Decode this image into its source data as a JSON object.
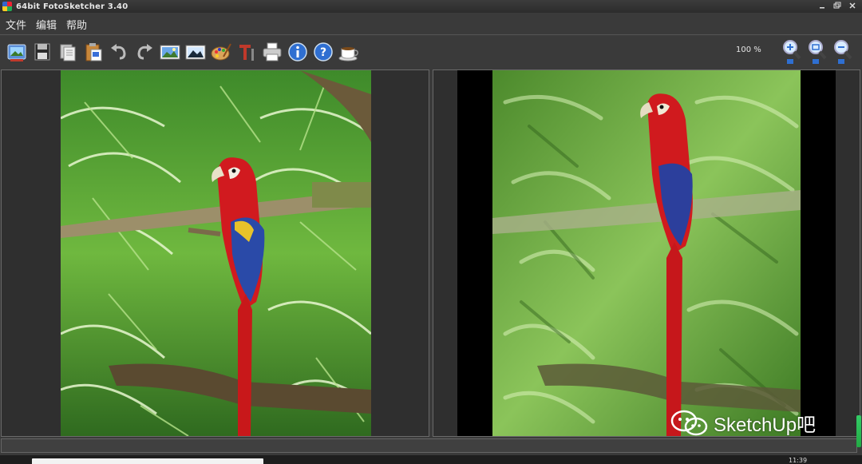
{
  "window": {
    "title": "64bit FotoSketcher 3.40",
    "controls": [
      "minimize-icon",
      "restore-icon",
      "close-icon"
    ]
  },
  "menu": {
    "items": [
      "文件",
      "编辑",
      "帮助"
    ]
  },
  "toolbar": {
    "buttons": [
      "open-image-icon",
      "save-icon",
      "copy-icon",
      "paste-icon",
      "undo-icon",
      "redo-icon",
      "original-image-icon",
      "result-image-icon",
      "drawing-parameters-icon",
      "text-icon",
      "print-icon",
      "info-icon",
      "help-icon",
      "coffee-icon"
    ],
    "zoom_label": "100 %",
    "zoom_buttons": [
      "zoom-in-icon",
      "zoom-fit-icon",
      "zoom-out-icon"
    ]
  },
  "panels": {
    "original": {
      "content": "parrot-photo"
    },
    "result": {
      "content": "parrot-painting"
    }
  },
  "watermark": {
    "text": "SketchUp吧"
  },
  "taskbar": {
    "clock": "11:39"
  },
  "colors": {
    "background": "#3a3a3a",
    "panel": "#2f2f2f",
    "parrot_red": "#d11a1f",
    "parrot_blue": "#2a4aa8",
    "foliage": "#4f9a2f"
  }
}
